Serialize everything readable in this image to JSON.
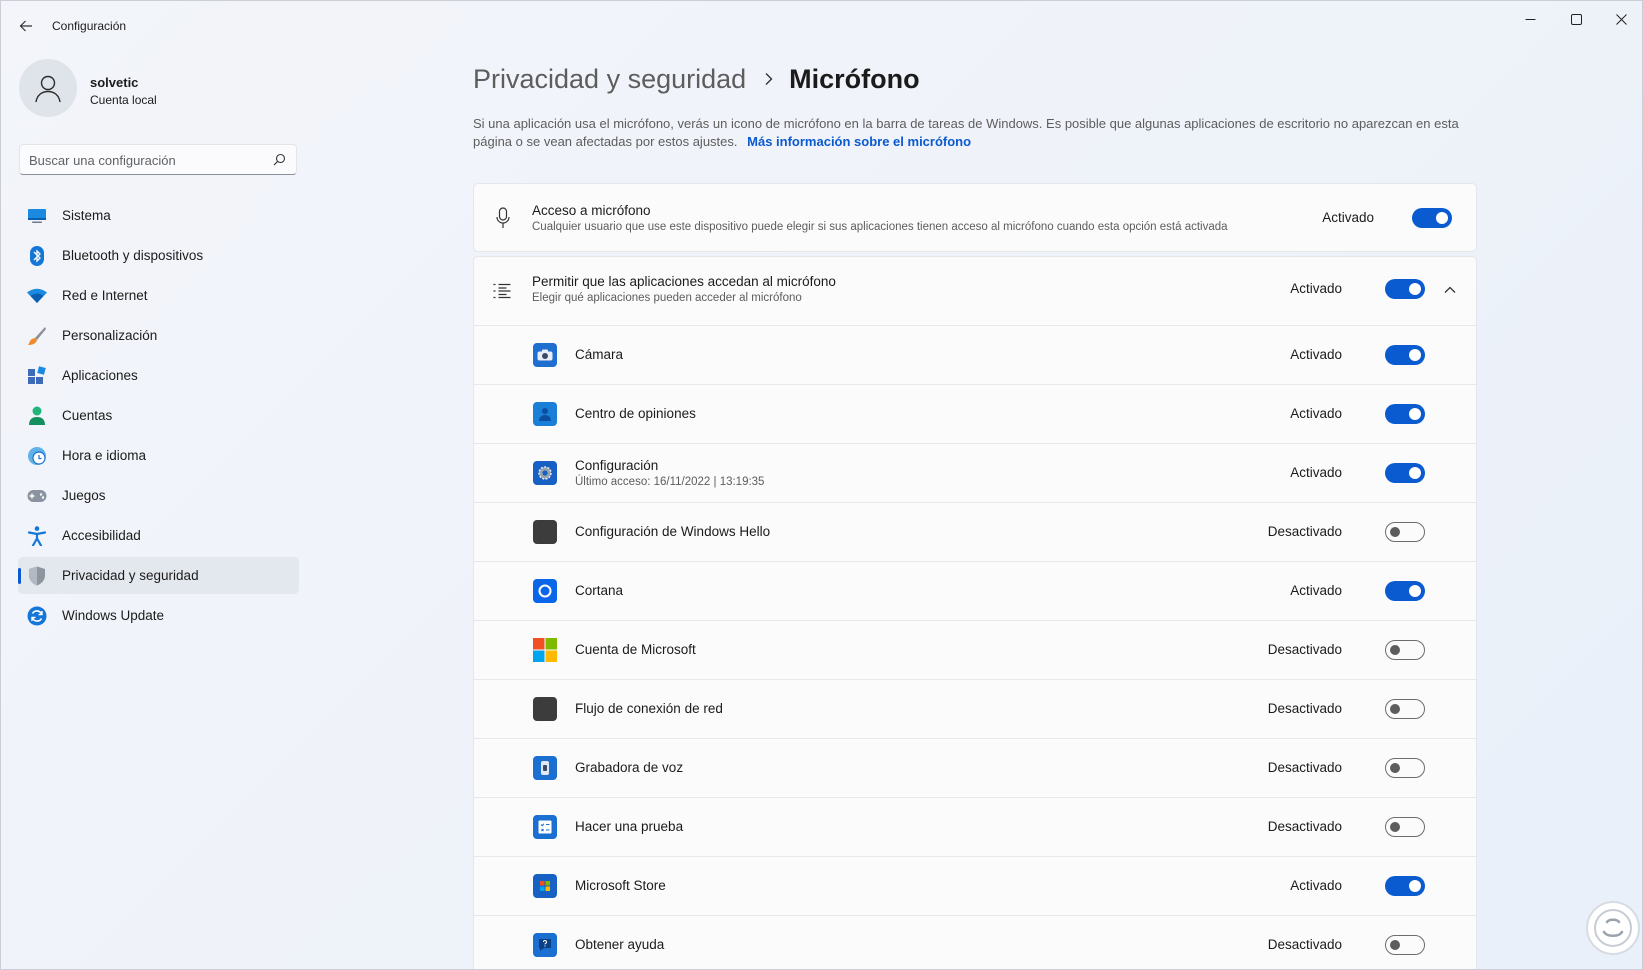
{
  "window": {
    "title": "Configuración"
  },
  "profile": {
    "name": "solvetic",
    "account_type": "Cuenta local"
  },
  "search": {
    "placeholder": "Buscar una configuración"
  },
  "sidebar": {
    "items": [
      {
        "label": "Sistema",
        "icon": "monitor-icon"
      },
      {
        "label": "Bluetooth y dispositivos",
        "icon": "bluetooth-icon"
      },
      {
        "label": "Red e Internet",
        "icon": "wifi-icon"
      },
      {
        "label": "Personalización",
        "icon": "brush-icon"
      },
      {
        "label": "Aplicaciones",
        "icon": "apps-icon"
      },
      {
        "label": "Cuentas",
        "icon": "person-icon"
      },
      {
        "label": "Hora e idioma",
        "icon": "clock-globe-icon"
      },
      {
        "label": "Juegos",
        "icon": "gamepad-icon"
      },
      {
        "label": "Accesibilidad",
        "icon": "accessibility-icon"
      },
      {
        "label": "Privacidad y seguridad",
        "icon": "shield-icon",
        "active": true
      },
      {
        "label": "Windows Update",
        "icon": "update-icon"
      }
    ]
  },
  "breadcrumb": {
    "parent": "Privacidad y seguridad",
    "current": "Micrófono"
  },
  "description": {
    "text": "Si una aplicación usa el micrófono, verás un icono de micrófono en la barra de tareas de Windows. Es posible que algunas aplicaciones de escritorio no aparezcan en esta página o se vean afectadas por estos ajustes.",
    "link": "Más información sobre el micrófono"
  },
  "access": {
    "title": "Acceso a micrófono",
    "subtitle": "Cualquier usuario que use este dispositivo puede elegir si sus aplicaciones tienen acceso al micrófono cuando esta opción está activada",
    "state": "Activado",
    "on": true
  },
  "apps_section": {
    "title": "Permitir que las aplicaciones accedan al micrófono",
    "subtitle": "Elegir qué aplicaciones pueden acceder al micrófono",
    "state": "Activado",
    "on": true
  },
  "apps": [
    {
      "name": "Cámara",
      "state": "Activado",
      "on": true,
      "icon": "camera-app-icon",
      "color": "#1f6fd0"
    },
    {
      "name": "Centro de opiniones",
      "state": "Activado",
      "on": true,
      "icon": "feedback-hub-icon",
      "color": "#1a7fd6"
    },
    {
      "name": "Configuración",
      "last_access": "Último acceso: 16/11/2022  |  13:19:35",
      "state": "Activado",
      "on": true,
      "icon": "settings-app-icon",
      "color": "#1760c4"
    },
    {
      "name": "Configuración de Windows Hello",
      "state": "Desactivado",
      "on": false,
      "icon": "windows-hello-icon",
      "color": "#3c3c3c"
    },
    {
      "name": "Cortana",
      "state": "Activado",
      "on": true,
      "icon": "cortana-icon",
      "color": "#0a66e8"
    },
    {
      "name": "Cuenta de Microsoft",
      "state": "Desactivado",
      "on": false,
      "icon": "microsoft-logo-icon",
      "color": "#f25022"
    },
    {
      "name": "Flujo de conexión de red",
      "state": "Desactivado",
      "on": false,
      "icon": "network-flow-icon",
      "color": "#3c3c3c"
    },
    {
      "name": "Grabadora de voz",
      "state": "Desactivado",
      "on": false,
      "icon": "voice-recorder-icon",
      "color": "#1a6fd0"
    },
    {
      "name": "Hacer una prueba",
      "state": "Desactivado",
      "on": false,
      "icon": "take-a-test-icon",
      "color": "#1a6fd0"
    },
    {
      "name": "Microsoft Store",
      "state": "Activado",
      "on": true,
      "icon": "store-icon",
      "color": "#1760c4"
    },
    {
      "name": "Obtener ayuda",
      "state": "Desactivado",
      "on": false,
      "icon": "get-help-icon",
      "color": "#1a6fd0"
    }
  ],
  "colors": {
    "accent": "#0a5ad0",
    "link": "#0a5ad0"
  }
}
